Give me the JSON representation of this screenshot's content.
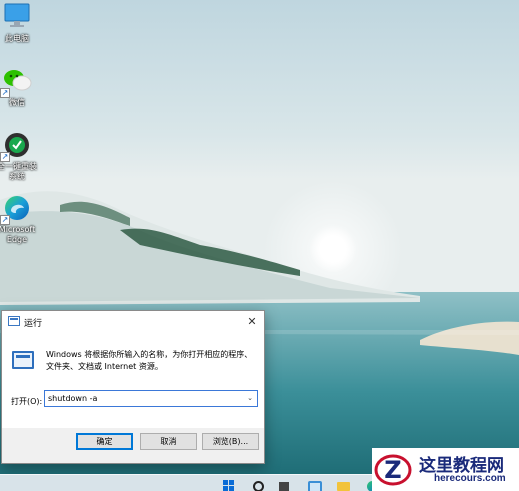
{
  "desktop": {
    "icons": [
      {
        "label": "此电脑",
        "icon": "this-pc-icon"
      },
      {
        "label": "微信",
        "icon": "wechat-icon"
      },
      {
        "label": "全一键重装系统",
        "icon": "reinstall-tool-icon"
      },
      {
        "label": "Microsoft Edge",
        "icon": "edge-icon"
      }
    ]
  },
  "run_dialog": {
    "title": "运行",
    "close_glyph": "✕",
    "description": "Windows 将根据你所输入的名称，为你打开相应的程序、文件夹、文档或 Internet 资源。",
    "open_label": "打开(O):",
    "input_value": "shutdown -a",
    "dropdown_glyph": "⌄",
    "buttons": {
      "ok": "确定",
      "cancel": "取消",
      "browse": "浏览(B)..."
    }
  },
  "taskbar": {
    "icons": [
      "start-icon",
      "search-icon",
      "task-view-icon",
      "widgets-icon",
      "file-explorer-icon",
      "edge-icon"
    ]
  },
  "watermark": {
    "title": "这里教程网",
    "url": "herecours.com"
  },
  "colors": {
    "accent": "#0078d7",
    "taskbar_start": "#0a6cd6",
    "watermark_text": "#1a2a7a",
    "watermark_logo_red": "#c8102e"
  }
}
